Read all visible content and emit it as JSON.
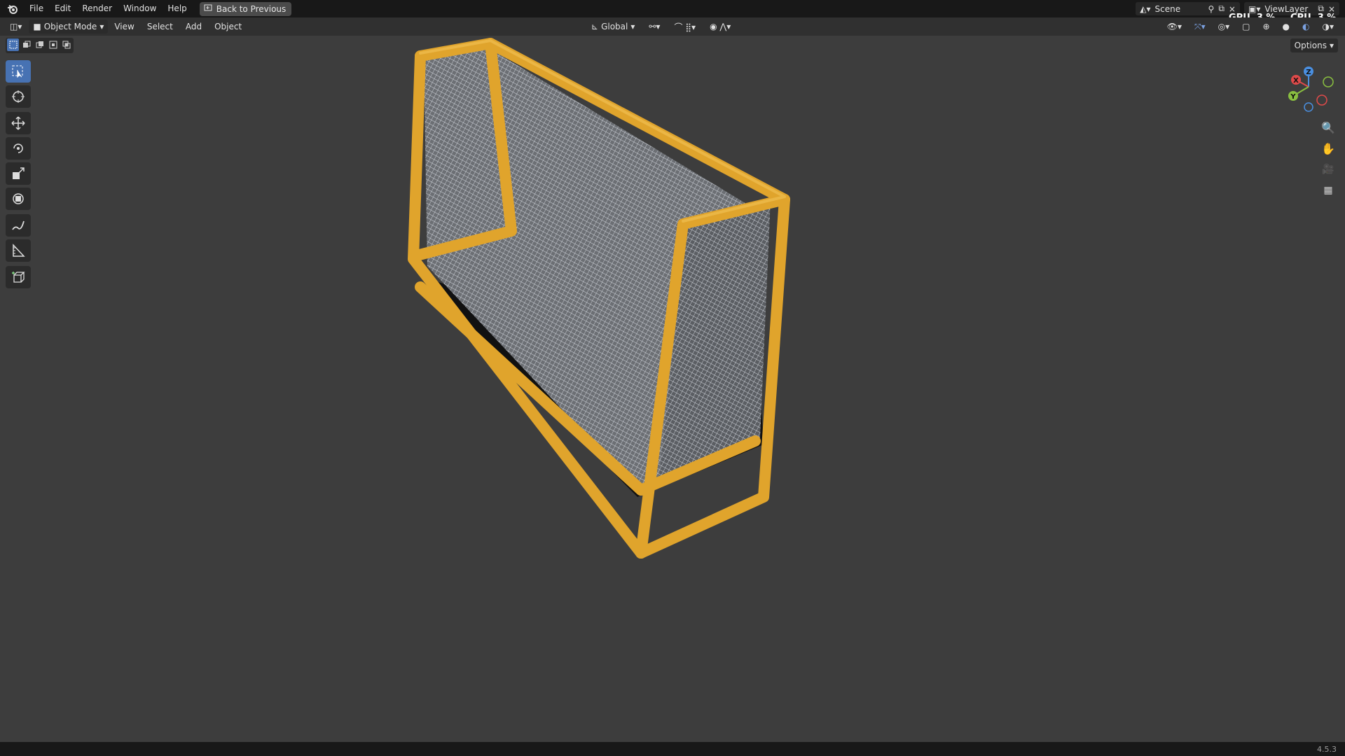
{
  "topbar": {
    "menus": [
      "File",
      "Edit",
      "Render",
      "Window",
      "Help"
    ],
    "back_button": "Back to Previous",
    "scene_name": "Scene",
    "view_layer": "ViewLayer",
    "gpu_label": "GPU",
    "gpu_value": "3 %",
    "cpu_label": "CPU",
    "cpu_value": "3 %"
  },
  "header": {
    "mode": "Object Mode",
    "menus": [
      "View",
      "Select",
      "Add",
      "Object"
    ],
    "orientation": "Global"
  },
  "viewport": {
    "options_label": "Options",
    "gizmo_axes": {
      "x": "X",
      "y": "Y",
      "z": "Z"
    }
  },
  "toolbar": {
    "tools": [
      "select-box",
      "cursor",
      "move",
      "rotate",
      "scale",
      "transform",
      "annotate",
      "measure",
      "add-cube"
    ],
    "active_tool": "select-box"
  },
  "statusbar": {
    "version": "4.5.3"
  },
  "colors": {
    "frame": "#e0a42c",
    "net": "#c8ccd4",
    "accent": "#4772b3",
    "viewport_bg": "#3d3d3d"
  }
}
